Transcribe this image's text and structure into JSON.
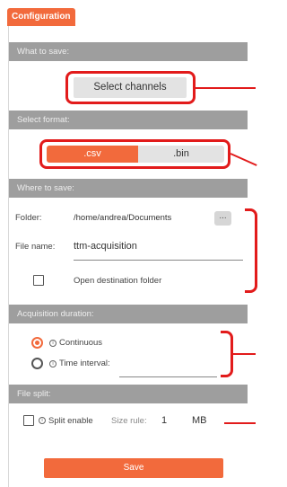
{
  "tab": {
    "label": "Configuration"
  },
  "sections": {
    "what_to_save": "What to save:",
    "select_format": "Select format:",
    "where_to_save": "Where to save:",
    "acquisition_duration": "Acquisition duration:",
    "file_split": "File split:"
  },
  "what_to_save": {
    "select_channels_label": "Select channels"
  },
  "format": {
    "options": [
      ".csv",
      ".bin"
    ],
    "selected": ".csv"
  },
  "where_to_save": {
    "folder_label": "Folder:",
    "folder_value": "/home/andrea/Documents",
    "browse_label": "...",
    "file_name_label": "File name:",
    "file_name_value": "ttm-acquisition",
    "open_folder_label": "Open destination folder",
    "open_folder_checked": false
  },
  "acquisition": {
    "continuous_label": "Continuous",
    "time_interval_label": "Time interval:",
    "selected": "continuous",
    "time_interval_value": ""
  },
  "file_split": {
    "split_enable_label": "Split enable",
    "split_enable_checked": false,
    "size_rule_label": "Size rule:",
    "size_value": "1",
    "size_unit": "MB"
  },
  "save": {
    "label": "Save"
  },
  "colors": {
    "accent": "#f26a3c",
    "header_bg": "#9e9e9e",
    "highlight": "#e21b1b"
  }
}
